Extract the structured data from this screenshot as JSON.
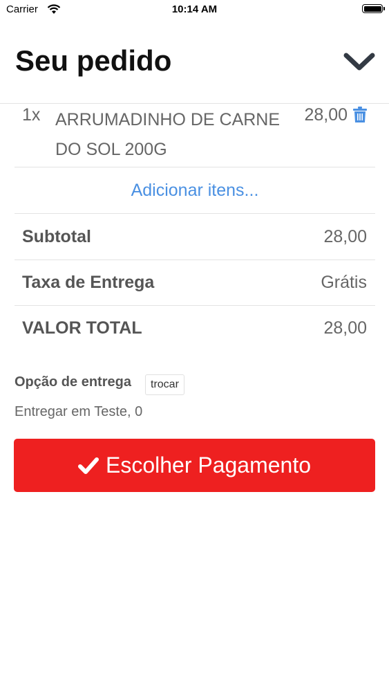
{
  "status_bar": {
    "carrier": "Carrier",
    "time": "10:14 AM"
  },
  "header": {
    "title": "Seu pedido"
  },
  "order": {
    "items": [
      {
        "qty": "1x",
        "name": "ARRUMADINHO DE CARNE DO SOL 200G",
        "price": "28,00"
      }
    ],
    "add_items_label": "Adicionar itens..."
  },
  "summary": {
    "subtotal_label": "Subtotal",
    "subtotal_value": "28,00",
    "delivery_fee_label": "Taxa de Entrega",
    "delivery_fee_value": "Grátis",
    "total_label": "VALOR TOTAL",
    "total_value": "28,00"
  },
  "delivery": {
    "label": "Opção de entrega",
    "change_label": "trocar",
    "address": "Entregar em Teste, 0"
  },
  "actions": {
    "pay_label": "Escolher Pagamento"
  },
  "colors": {
    "accent_red": "#ee2020",
    "link_blue": "#4a90e2",
    "trash_blue": "#4a90e2"
  },
  "icons": {
    "collapse": "chevron-down-icon",
    "trash": "trash-icon",
    "check": "check-icon"
  }
}
